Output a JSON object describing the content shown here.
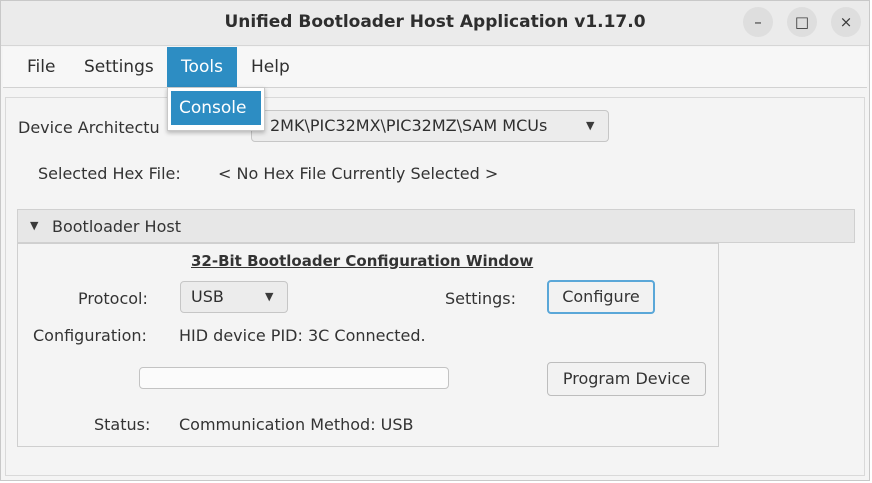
{
  "window": {
    "title": "Unified Bootloader Host Application v1.17.0",
    "minimize_glyph": "–",
    "maximize_glyph": "□",
    "close_glyph": "×"
  },
  "menu": {
    "items": [
      "File",
      "Settings",
      "Tools",
      "Help"
    ],
    "active": "Tools",
    "dropdown": {
      "items": [
        "Console"
      ]
    }
  },
  "device": {
    "label": "Device Architectu",
    "selected": "2MK\\PIC32MX\\PIC32MZ\\SAM MCUs"
  },
  "hex": {
    "label": "Selected Hex File:",
    "value": "< No Hex File Currently Selected >"
  },
  "panel": {
    "title": "Bootloader Host",
    "heading": "32-Bit Bootloader Configuration Window",
    "protocol_label": "Protocol:",
    "protocol_value": "USB",
    "settings_label": "Settings:",
    "configure_label": "Configure",
    "configuration_label": "Configuration:",
    "configuration_value": "HID device PID: 3C Connected.",
    "program_label": "Program Device",
    "progress": 0,
    "status_label": "Status:",
    "status_value": "Communication Method: USB"
  },
  "colors": {
    "accent": "#2d8dc3",
    "focus": "#5aa7d8"
  }
}
